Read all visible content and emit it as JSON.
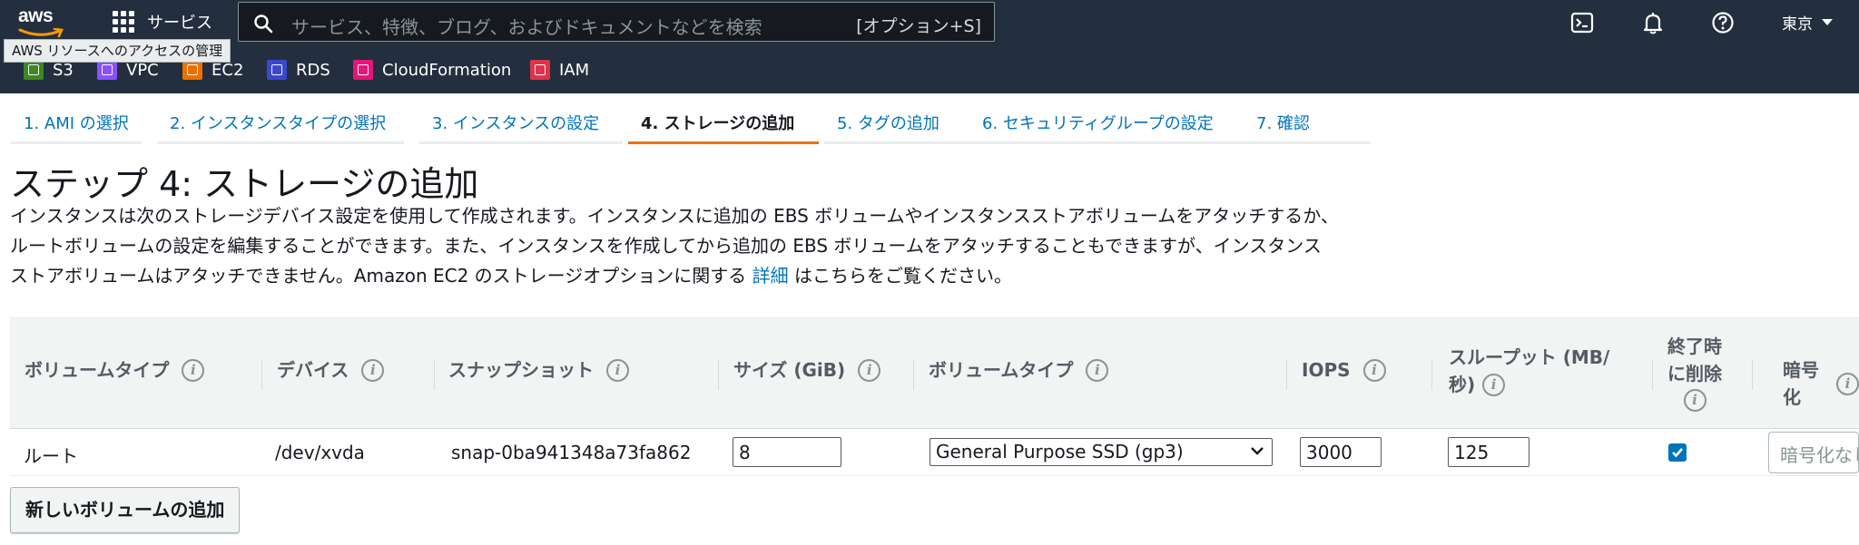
{
  "nav": {
    "logo": "aws",
    "services_label": "サービス",
    "search_placeholder": "サービス、特徴、ブログ、およびドキュメントなどを検索",
    "search_shortcut": "[オプション+S]",
    "region": "東京",
    "tooltip": "AWS リソースへのアクセスの管理"
  },
  "favorites": [
    {
      "label": "S3",
      "icon": "s3-icon",
      "color": "#3f8624"
    },
    {
      "label": "VPC",
      "icon": "vpc-icon",
      "color": "#8c4fff"
    },
    {
      "label": "EC2",
      "icon": "ec2-icon",
      "color": "#ed7100"
    },
    {
      "label": "RDS",
      "icon": "rds-icon",
      "color": "#3b48cc"
    },
    {
      "label": "CloudFormation",
      "icon": "cloudformation-icon",
      "color": "#e7157b"
    },
    {
      "label": "IAM",
      "icon": "iam-icon",
      "color": "#dd344c"
    }
  ],
  "tabs": [
    {
      "label": "1. AMI の選択",
      "active": false
    },
    {
      "label": "2. インスタンスタイプの選択",
      "active": false
    },
    {
      "label": "3. インスタンスの設定",
      "active": false
    },
    {
      "label": "4. ストレージの追加",
      "active": true
    },
    {
      "label": "5. タグの追加",
      "active": false
    },
    {
      "label": "6. セキュリティグループの設定",
      "active": false
    },
    {
      "label": "7. 確認",
      "active": false
    }
  ],
  "page": {
    "title": "ステップ 4: ストレージの追加",
    "desc_line1": "インスタンスは次のストレージデバイス設定を使用して作成されます。インスタンスに追加の EBS ボリュームやインスタンスストアボリュームをアタッチするか、",
    "desc_line2": "ルートボリュームの設定を編集することができます。また、インスタンスを作成してから追加の EBS ボリュームをアタッチすることもできますが、インスタンス",
    "desc_line3_pre": "ストアボリュームはアタッチできません。Amazon EC2 のストレージオプションに関する",
    "desc_link": "詳細",
    "desc_line3_post": "はこちらをご覧ください。"
  },
  "table": {
    "headers": {
      "volume_type": "ボリュームタイプ",
      "device": "デバイス",
      "snapshot": "スナップショット",
      "size": "サイズ (GiB)",
      "ebs_type": "ボリュームタイプ",
      "iops": "IOPS",
      "throughput_l1": "スループット (MB/",
      "throughput_l2": "秒)",
      "delete_l1": "終了時",
      "delete_l2": "に削除",
      "encryption": "暗号化"
    },
    "row": {
      "volume_type": "ルート",
      "device": "/dev/xvda",
      "snapshot": "snap-0ba941348a73fa862",
      "size": "8",
      "ebs_type": "General Purpose SSD (gp3)",
      "iops": "3000",
      "throughput": "125",
      "delete_on_termination": true,
      "encryption_placeholder": "暗号化なし"
    }
  },
  "add_volume_button": "新しいボリュームの追加"
}
